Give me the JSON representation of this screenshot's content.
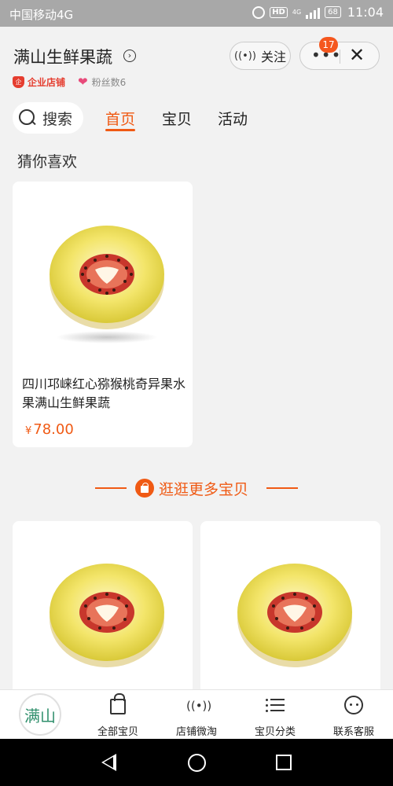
{
  "status_bar": {
    "carrier": "中国移动4G",
    "hd": "HD",
    "network": "4G",
    "battery": "68",
    "time": "11:04"
  },
  "shop": {
    "name": "满山生鲜果蔬",
    "enterprise_label": "企业店铺",
    "fans_label": "粉丝数6",
    "follow_label": "关注",
    "notification_count": "17",
    "logo_text": "满山"
  },
  "nav": {
    "search_label": "搜索",
    "tabs": [
      {
        "label": "首页",
        "active": true
      },
      {
        "label": "宝贝",
        "active": false
      },
      {
        "label": "活动",
        "active": false
      }
    ]
  },
  "section_title": "猜你喜欢",
  "featured_product": {
    "title": "四川邛崃红心猕猴桃奇异果水果满山生鲜果蔬",
    "currency": "¥",
    "price": "78.00"
  },
  "more_label": "逛逛更多宝贝",
  "bottom_bar": {
    "items": [
      {
        "label": "全部宝贝",
        "icon": "bag-icon"
      },
      {
        "label": "店铺微淘",
        "icon": "broadcast-icon"
      },
      {
        "label": "宝贝分类",
        "icon": "list-icon"
      },
      {
        "label": "联系客服",
        "icon": "chat-face-icon"
      }
    ]
  },
  "colors": {
    "accent": "#f05a14",
    "badge": "#f5571e",
    "enterprise": "#e53d2f"
  }
}
